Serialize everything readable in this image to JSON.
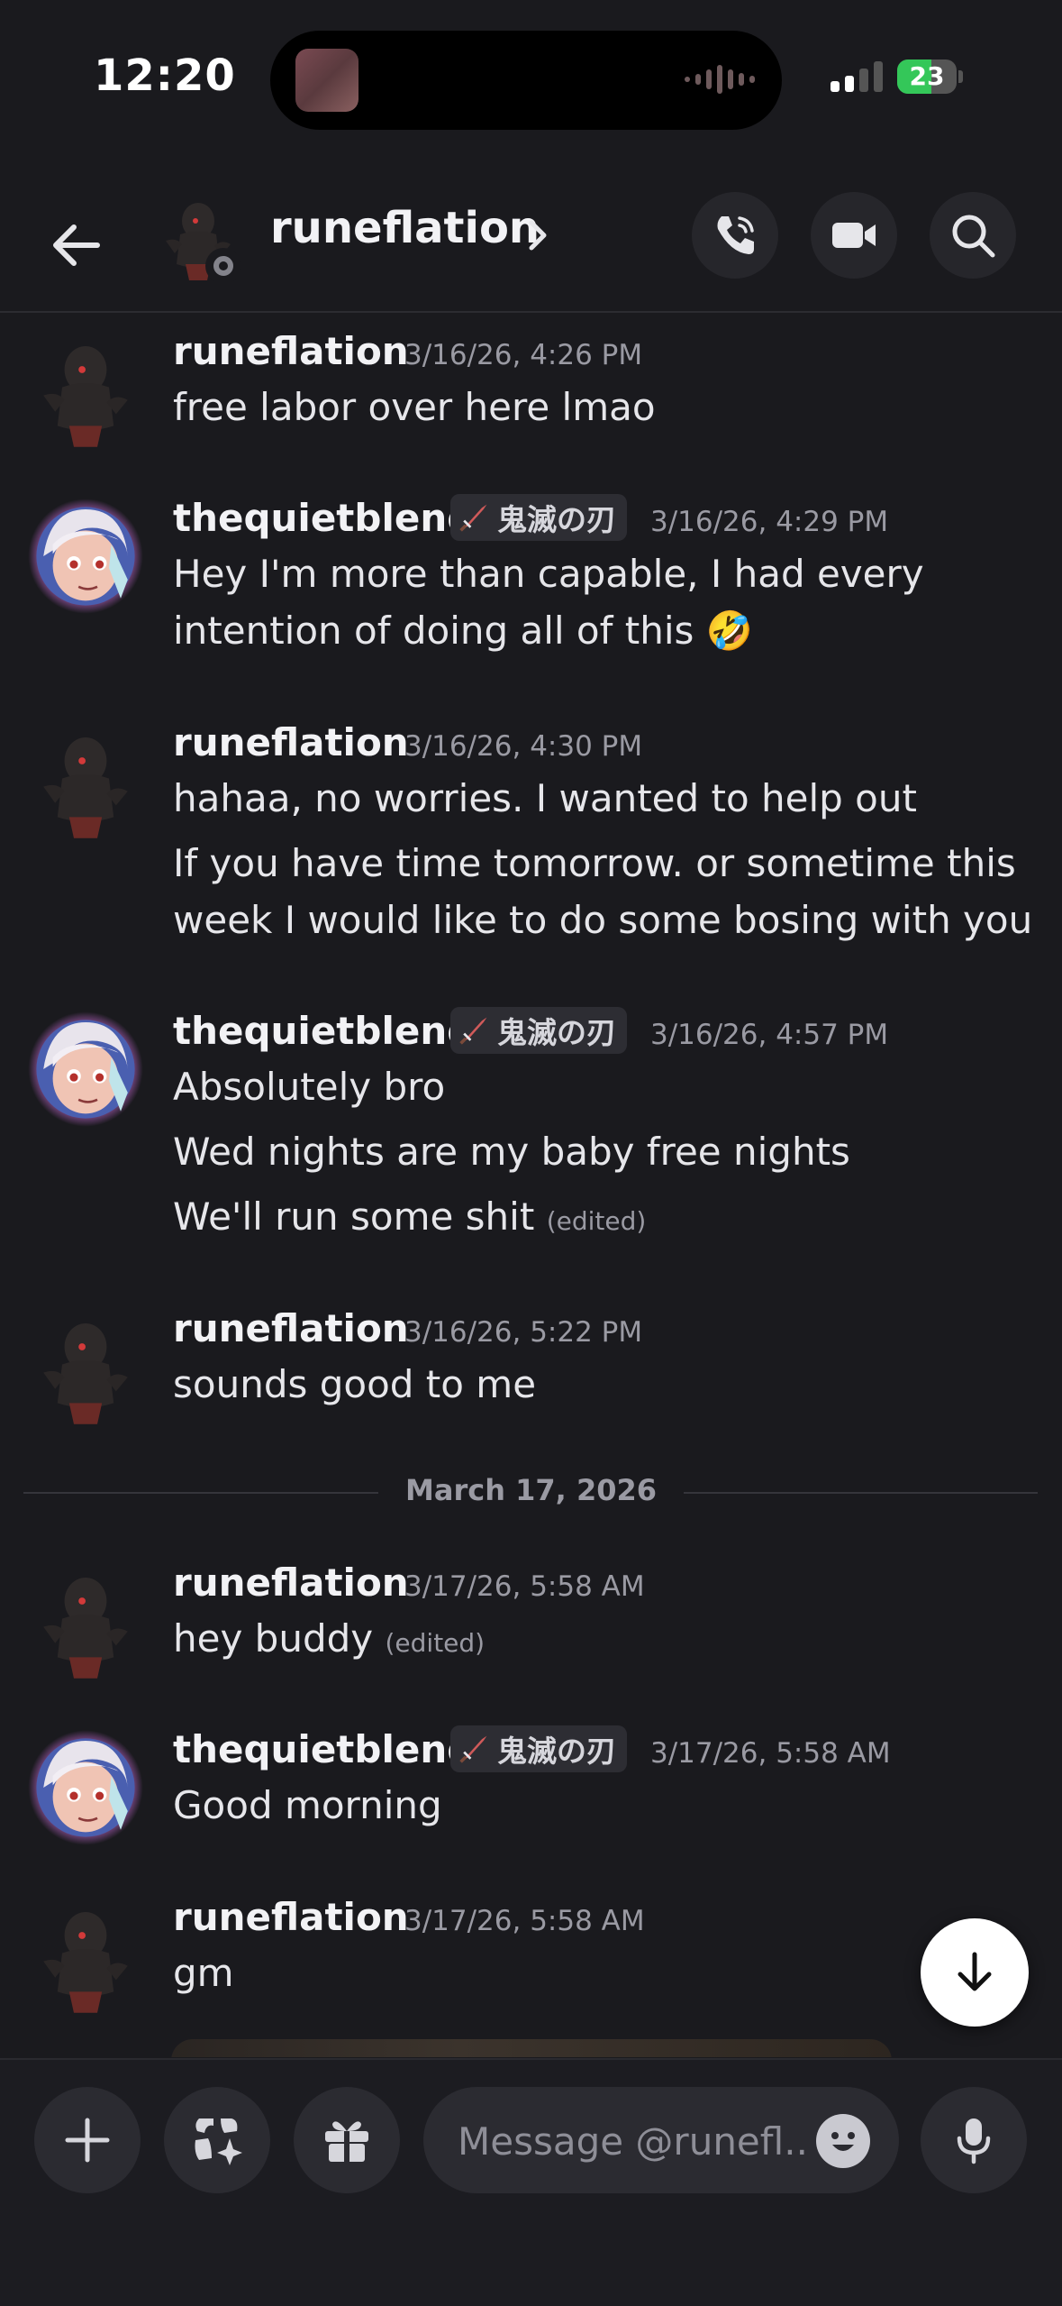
{
  "status_bar": {
    "time": "12:20",
    "battery": "23"
  },
  "header": {
    "name": "runeflation"
  },
  "messages": [
    {
      "user": "runeflation",
      "timestamp": "3/16/26, 4:26 PM",
      "lines": [
        "free labor over here lmao"
      ]
    },
    {
      "user": "thequietblend",
      "tag": "鬼滅の刃",
      "timestamp": "3/16/26, 4:29 PM",
      "lines": [
        "Hey I'm more than capable, I had every",
        "intention of doing all of this 🤣"
      ]
    },
    {
      "user": "runeflation",
      "timestamp": "3/16/26, 4:30 PM",
      "lines": [
        "hahaa, no worries. I wanted to help out",
        "If you have time tomorrow. or sometime this",
        "week I would like to do some bosing with you"
      ]
    },
    {
      "user": "thequietblend",
      "tag": "鬼滅の刃",
      "timestamp": "3/16/26, 4:57 PM",
      "lines": [
        "Absolutely bro",
        "Wed nights are my baby free nights",
        "We'll run some shit"
      ],
      "edited": "(edited)"
    },
    {
      "user": "runeflation",
      "timestamp": "3/16/26, 5:22 PM",
      "lines": [
        "sounds good to me"
      ]
    },
    {
      "user": "runeflation",
      "timestamp": "3/17/26, 5:58 AM",
      "lines": [
        "hey buddy"
      ],
      "edited": "(edited)"
    },
    {
      "user": "thequietblend",
      "tag": "鬼滅の刃",
      "timestamp": "3/17/26, 5:58 AM",
      "lines": [
        "Good morning"
      ]
    },
    {
      "user": "runeflation",
      "timestamp": "3/17/26, 5:58 AM",
      "lines": [
        "gm"
      ]
    }
  ],
  "date_divider": "March 17, 2026",
  "composer": {
    "placeholder": "Message @runefl.."
  },
  "icons": {
    "back": "arrow-left-icon",
    "call": "phone-icon",
    "video": "video-camera-icon",
    "search": "search-icon",
    "add": "plus-icon",
    "apps": "apps-sparkle-icon",
    "gift": "gift-icon",
    "emoji": "emoji-icon",
    "mic": "microphone-icon",
    "scroll": "arrow-down-icon"
  },
  "colors": {
    "background": "#1a1a1e",
    "online_battery": "#34c759",
    "status_offline": "#83838b"
  }
}
